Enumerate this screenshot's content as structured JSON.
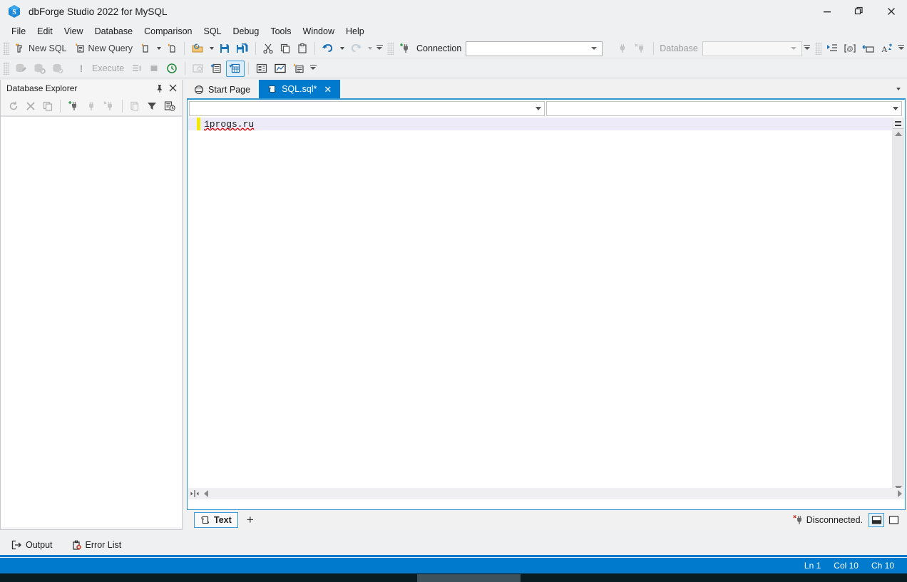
{
  "window": {
    "title": "dbForge Studio 2022 for MySQL",
    "logo_icon": "dbforge-logo-icon",
    "controls": {
      "minimize": "–",
      "maximize": "❐",
      "close": "✕"
    }
  },
  "menubar": {
    "items": [
      {
        "label": "File",
        "accel": "F"
      },
      {
        "label": "Edit",
        "accel": "E"
      },
      {
        "label": "View",
        "accel": "V"
      },
      {
        "label": "Database",
        "accel": "D"
      },
      {
        "label": "Comparison",
        "accel": "m"
      },
      {
        "label": "SQL",
        "accel": "S"
      },
      {
        "label": "Debug",
        "accel": "b"
      },
      {
        "label": "Tools",
        "accel": "T"
      },
      {
        "label": "Window",
        "accel": "W"
      },
      {
        "label": "Help",
        "accel": "H"
      }
    ]
  },
  "toolbar_main": {
    "new_sql": {
      "label": "New SQL",
      "icon": "new-sql-icon"
    },
    "new_query": {
      "label": "New Query",
      "icon": "new-query-icon"
    },
    "new_document": {
      "icon": "new-document-icon"
    },
    "new_object": {
      "icon": "new-object-icon"
    },
    "open": {
      "icon": "open-folder-icon"
    },
    "save": {
      "icon": "save-icon"
    },
    "save_all": {
      "icon": "save-all-icon"
    },
    "cut": {
      "icon": "cut-scissors-icon"
    },
    "copy": {
      "icon": "copy-icon"
    },
    "paste": {
      "icon": "paste-icon"
    },
    "undo": {
      "icon": "undo-arrow-icon"
    },
    "redo": {
      "icon": "redo-arrow-icon"
    },
    "connection_label": "Connection",
    "connection_value": "",
    "new_connection": {
      "icon": "new-connection-plug-icon"
    },
    "connect": {
      "icon": "connect-plug-icon"
    },
    "disconnect": {
      "icon": "disconnect-plug-icon"
    },
    "database_label": "Database",
    "database_value": "",
    "indent": {
      "icon": "indent-icon"
    },
    "at_brackets": {
      "icon": "at-brackets-icon"
    },
    "rename": {
      "icon": "rename-icon"
    },
    "format_text": {
      "icon": "format-text-icon"
    }
  },
  "toolbar_sql": {
    "edit_data": {
      "icon": "edit-data-db-icon"
    },
    "refresh_db": {
      "icon": "refresh-db-icon"
    },
    "validate_db": {
      "icon": "validate-db-icon"
    },
    "execute_bang": {
      "icon": "execute-bang-icon"
    },
    "execute": {
      "label": "Execute",
      "icon": "execute-icon"
    },
    "execute_script": {
      "icon": "execute-to-file-icon"
    },
    "stop": {
      "icon": "stop-square-icon"
    },
    "execution_history": {
      "icon": "execution-history-icon"
    },
    "query_profiler": {
      "icon": "query-profiler-icon"
    },
    "result_grid": {
      "icon": "result-grid-icon"
    },
    "result_text": {
      "icon": "result-text-icon",
      "checked": true
    },
    "result_file": {
      "icon": "result-to-file-icon"
    },
    "execution_plan": {
      "icon": "execution-plan-chart-icon"
    },
    "new_result": {
      "icon": "new-result-icon"
    }
  },
  "database_explorer": {
    "title": "Database Explorer",
    "pin_icon": "pin-icon",
    "close_icon": "close-icon",
    "toolbar": [
      {
        "name": "refresh",
        "icon": "refresh-icon"
      },
      {
        "name": "delete",
        "icon": "delete-x-icon"
      },
      {
        "name": "duplicate",
        "icon": "duplicate-icon"
      },
      {
        "name": "new-connection",
        "icon": "new-connection-plug-icon"
      },
      {
        "name": "connect",
        "icon": "connect-plug-icon"
      },
      {
        "name": "disconnect",
        "icon": "disconnect-plug-icon"
      },
      {
        "name": "copy",
        "icon": "copy-icon"
      },
      {
        "name": "filter",
        "icon": "filter-funnel-icon"
      },
      {
        "name": "recent",
        "icon": "recent-objects-icon"
      }
    ]
  },
  "document_tabs": {
    "tabs": [
      {
        "label": "Start Page",
        "icon": "start-page-icon",
        "active": false,
        "closable": false
      },
      {
        "label": "SQL.sql*",
        "icon": "sql-document-icon",
        "active": true,
        "closable": true,
        "close_glyph": "✕"
      }
    ],
    "overflow_icon": "chevron-down-icon"
  },
  "editor": {
    "nav_left_value": "",
    "nav_right_value": "",
    "code_lines": [
      "1progs.ru"
    ],
    "spellcheck_underline_color": "#e00000",
    "change_bar_color": "#f2e900",
    "current_line_bg": "#ecebf7"
  },
  "doc_footer": {
    "result_tab": {
      "label": "Text",
      "icon": "text-result-icon"
    },
    "add_tab_glyph": "+",
    "connection_status": "Disconnected.",
    "connection_status_icon": "disconnect-plug-icon",
    "layout_split": {
      "icon": "layout-split-icon",
      "active": true
    },
    "layout_single": {
      "icon": "layout-single-icon",
      "active": false
    }
  },
  "bottom_dock": {
    "tabs": [
      {
        "label": "Output",
        "icon": "output-icon",
        "active": true
      },
      {
        "label": "Error List",
        "icon": "error-list-icon",
        "active": false
      }
    ]
  },
  "statusbar": {
    "line": "Ln 1",
    "column": "Col 10",
    "char": "Ch 10"
  },
  "colors": {
    "accent": "#007acc",
    "chrome": "#eff0f2",
    "editor_border": "#2f95d3"
  }
}
